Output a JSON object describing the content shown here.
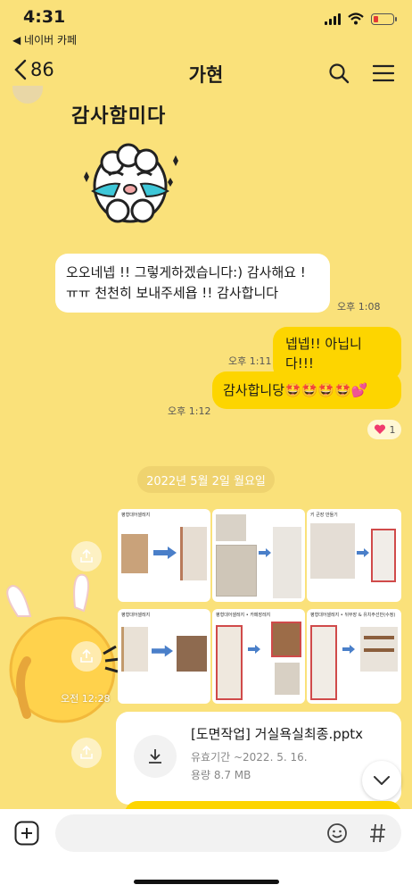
{
  "status": {
    "time": "4:31",
    "back_app": "◀ 네이버 카페"
  },
  "header": {
    "back_count": "86",
    "title": "가현"
  },
  "sticker": {
    "text": "감사함미다"
  },
  "messages": {
    "received_line1": "오오네넵 !! 그렇게하겠습니다:) 감사해요 !",
    "received_line2": "ㅠㅠ 천천히 보내주세욥 !! 감사합니다",
    "received_time": "오후 1:08",
    "sent1_text": "넵넵!! 아닙니다!!!",
    "sent1_time": "오후 1:11",
    "sent2_text": "감사합니당🤩🤩🤩🤩💕",
    "sent2_time": "오후 1:12",
    "reaction_count": "1"
  },
  "date_divider": "2022년 5월 2일 월요일",
  "photos": {
    "time": "오전 12:28",
    "slides": [
      "평형대어셀레지",
      "키 큰장 만들기",
      "평형대어셀레지",
      "평형대어셀레지 • 카페장레지",
      "평형대어셀레지 • 뒤부장 & 유치주선반(수정)"
    ]
  },
  "file": {
    "name": "[도면작업] 거실욕실최종.pptx",
    "expiry": "유효기간 ~2022. 5. 16.",
    "size": "용량 8.7 MB"
  },
  "icons": [
    "chevron-left-icon",
    "search-icon",
    "menu-icon",
    "share-icon",
    "download-icon",
    "chevron-down-icon",
    "plus-icon",
    "emoji-icon",
    "hash-icon",
    "heart-icon"
  ]
}
